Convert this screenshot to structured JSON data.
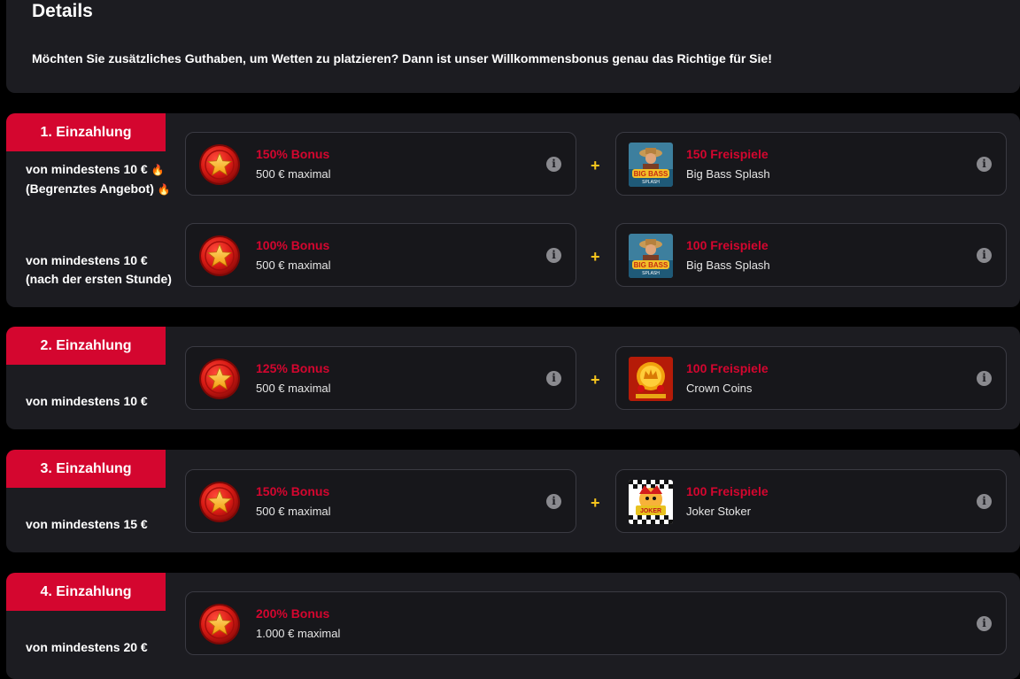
{
  "details": {
    "title": "Details",
    "intro": "Möchten Sie zusätzliches Guthaben, um Wetten zu platzieren? Dann ist unser Willkommensbonus genau das Richtige für Sie!"
  },
  "deposits": [
    {
      "label": "1. Einzahlung",
      "offers": [
        {
          "req_line1": "von mindestens 10 €",
          "req_line2": "(Begrenztes Angebot)",
          "bonus": {
            "title": "150% Bonus",
            "sub": "500 € maximal"
          },
          "spins": {
            "title": "150 Freispiele",
            "sub": "Big Bass Splash"
          }
        },
        {
          "req_line1": "von mindestens 10 €",
          "req_line2": "(nach der ersten Stunde)",
          "bonus": {
            "title": "100% Bonus",
            "sub": "500 € maximal"
          },
          "spins": {
            "title": "100 Freispiele",
            "sub": "Big Bass Splash"
          }
        }
      ]
    },
    {
      "label": "2. Einzahlung",
      "req": "von mindestens 10 €",
      "bonus": {
        "title": "125% Bonus",
        "sub": "500 € maximal"
      },
      "spins": {
        "title": "100 Freispiele",
        "sub": "Crown Coins"
      }
    },
    {
      "label": "3. Einzahlung",
      "req": "von mindestens 15 €",
      "bonus": {
        "title": "150% Bonus",
        "sub": "500 € maximal"
      },
      "spins": {
        "title": "100 Freispiele",
        "sub": "Joker Stoker"
      }
    },
    {
      "label": "4. Einzahlung",
      "req": "von mindestens 20 €",
      "bonus": {
        "title": "200% Bonus",
        "sub": "1.000 € maximal"
      }
    }
  ],
  "plus_sign": "+",
  "info_glyph": "i",
  "fire_emoji": "🔥",
  "icons": {
    "bonus": "star-coin-icon",
    "info": "info-icon",
    "thumb_bigbass": "big-bass-splash-thumbnail",
    "thumb_crown": "crown-coins-thumbnail",
    "thumb_joker": "joker-stoker-thumbnail"
  },
  "colors": {
    "accent": "#d4062f",
    "plus": "#f7c51d",
    "panel": "#1c1c21",
    "card_border": "#3a3a42"
  }
}
